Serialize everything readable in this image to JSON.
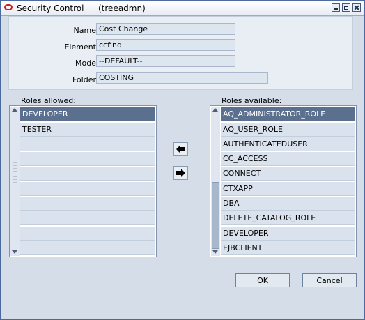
{
  "window": {
    "title": "Security Control",
    "subtitle": "(treeadmn)"
  },
  "fields": [
    {
      "label": "Name",
      "value": "Cost Change"
    },
    {
      "label": "Element",
      "value": "ccfind"
    },
    {
      "label": "Mode",
      "value": "--DEFAULT--"
    },
    {
      "label": "Folder",
      "value": "COSTING"
    }
  ],
  "roles_allowed": {
    "label": "Roles allowed:",
    "items": [
      "DEVELOPER",
      "TESTER"
    ],
    "selected": "DEVELOPER"
  },
  "roles_available": {
    "label": "Roles available:",
    "items": [
      "AQ_ADMINISTRATOR_ROLE",
      "AQ_USER_ROLE",
      "AUTHENTICATEDUSER",
      "CC_ACCESS",
      "CONNECT",
      "CTXAPP",
      "DBA",
      "DELETE_CATALOG_ROLE",
      "DEVELOPER",
      "EJBCLIENT"
    ],
    "selected": "AQ_ADMINISTRATOR_ROLE"
  },
  "buttons": {
    "ok": "OK",
    "cancel": "Cancel"
  },
  "icons": {
    "move_left": "arrow-left-icon",
    "move_right": "arrow-right-icon"
  }
}
